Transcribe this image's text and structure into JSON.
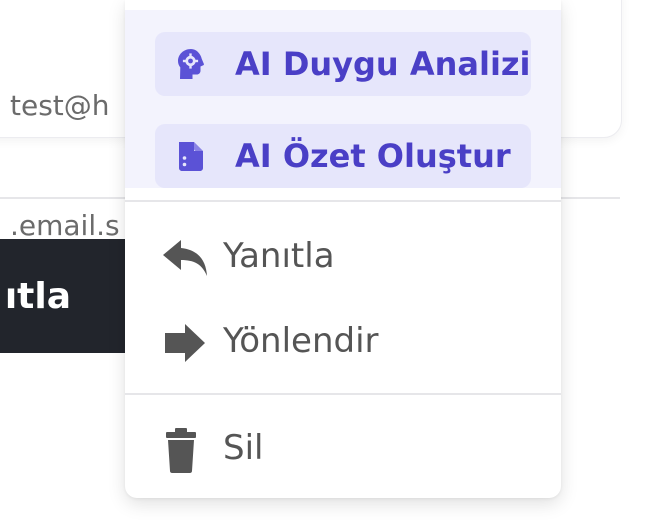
{
  "background": {
    "email_line1": "test@h",
    "email_line2": ".email.s",
    "reply_button_label": "ıtla"
  },
  "menu": {
    "ai_items": [
      {
        "label": "AI Duygu Analizi",
        "icon": "brain-gear-icon"
      },
      {
        "label": "AI Özet Oluştur",
        "icon": "document-icon"
      }
    ],
    "actions": [
      {
        "label": "Yanıtla",
        "icon": "reply-icon"
      },
      {
        "label": "Yönlendir",
        "icon": "forward-arrow-icon"
      }
    ],
    "delete": {
      "label": "Sil",
      "icon": "trash-icon"
    }
  },
  "colors": {
    "ai_accent": "#4a3fc6",
    "ai_item_bg": "#e6e6fb",
    "ai_section_bg": "#f3f3fd",
    "action_text": "#555555",
    "dark_button_bg": "#22252c"
  }
}
